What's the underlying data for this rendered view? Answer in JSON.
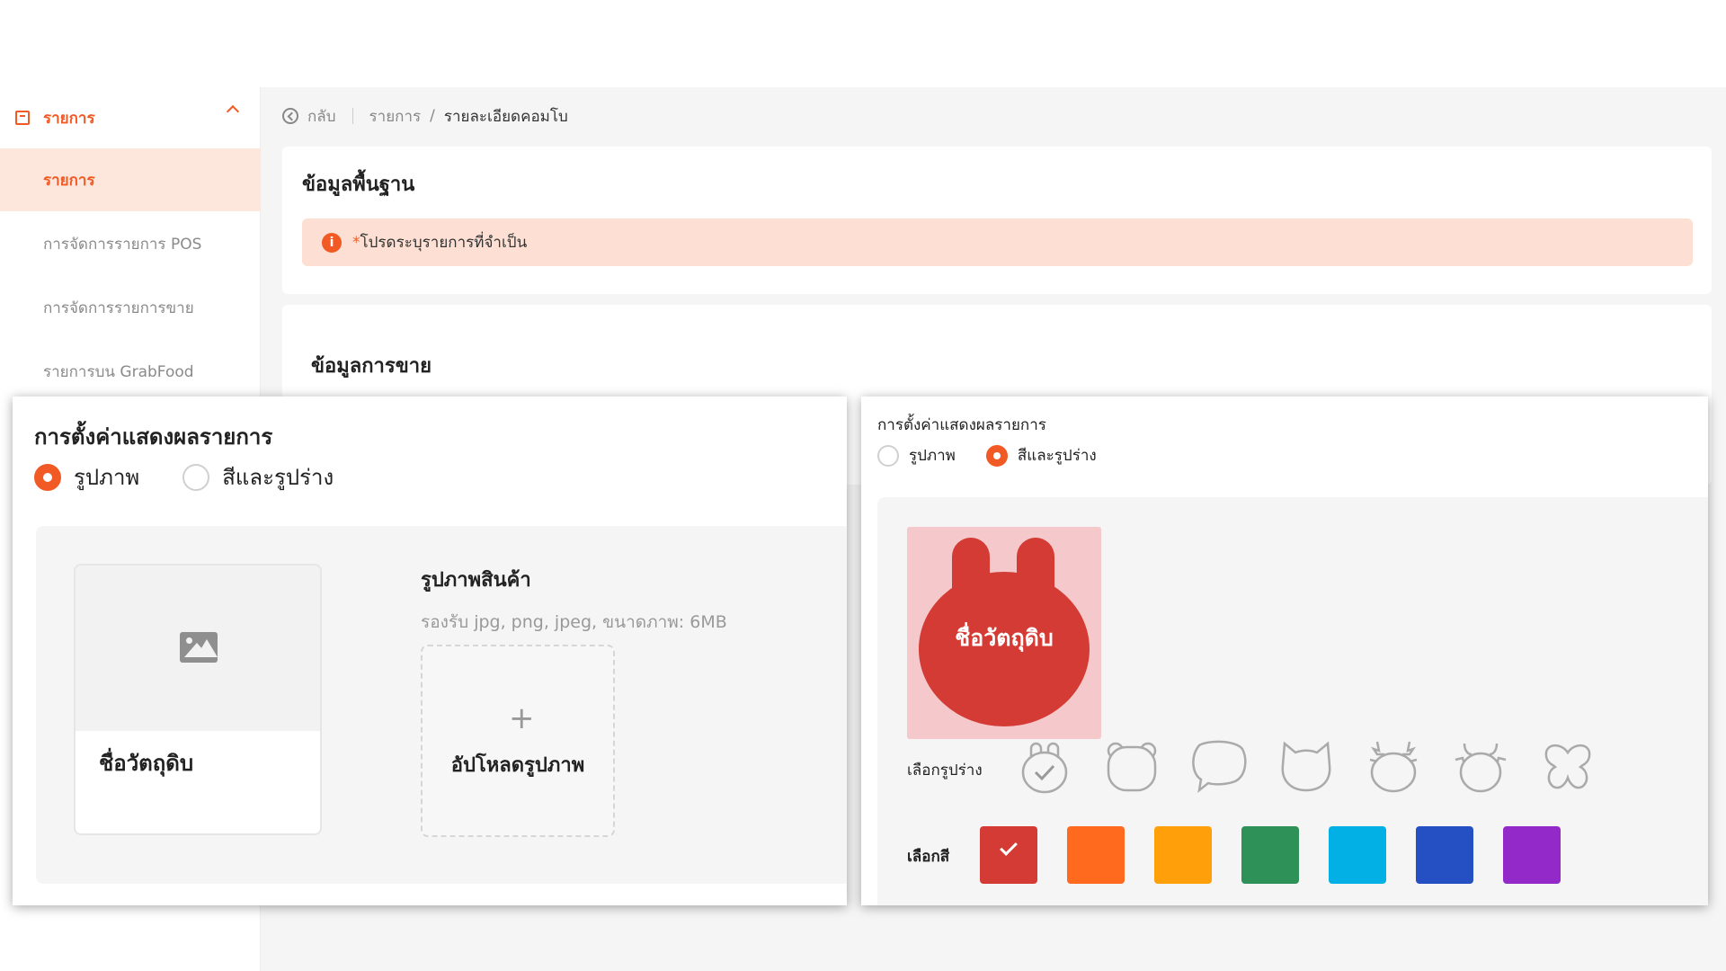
{
  "sidebar": {
    "group_label": "รายการ",
    "items": [
      {
        "label": "รายการ",
        "active": true
      },
      {
        "label": "การจัดการรายการ POS",
        "active": false
      },
      {
        "label": "การจัดการรายการขาย",
        "active": false
      },
      {
        "label": "รายการบน GrabFood",
        "active": false
      }
    ]
  },
  "breadcrumb": {
    "back": "กลับ",
    "parent": "รายการ",
    "separator": "/",
    "current": "รายละเอียดคอมโบ"
  },
  "basic_info": {
    "title": "ข้อมูลพื้นฐาน",
    "alert_icon": "i",
    "alert_star": "*",
    "alert_text": "โปรดระบุรายการที่จำเป็น"
  },
  "sales_info": {
    "title": "ข้อมูลการขาย"
  },
  "left_panel": {
    "title": "การตั้งค่าแสดงผลรายการ",
    "options": [
      {
        "label": "รูปภาพ",
        "selected": true
      },
      {
        "label": "สีและรูปร่าง",
        "selected": false
      }
    ],
    "preview_name": "ชื่อวัตถุดิบ",
    "upload_title": "รูปภาพสินค้า",
    "upload_hint": "รองรับ jpg, png, jpeg, ขนาดภาพ: 6MB",
    "upload_plus": "+",
    "upload_label": "อัปโหลดรูปภาพ"
  },
  "right_panel": {
    "title": "การตั้งค่าแสดงผลรายการ",
    "options": [
      {
        "label": "รูปภาพ",
        "selected": false
      },
      {
        "label": "สีและรูปร่าง",
        "selected": true
      }
    ],
    "preview_name": "ชื่อวัตถุดิบ",
    "shapes_label": "เลือกรูปร่าง",
    "shapes": [
      "bunny-shape-icon",
      "bear-shape-icon",
      "speech-bubble-shape-icon",
      "cat-shape-icon",
      "reindeer-shape-icon",
      "cow-shape-icon",
      "butterfly-shape-icon"
    ],
    "selected_shape": 0,
    "colors_label": "เลือกสี",
    "colors": [
      "#d33b34",
      "#ff6a1f",
      "#ff9f0a",
      "#2e9158",
      "#03b0e6",
      "#2450c4",
      "#9229c8"
    ],
    "selected_color": 0
  },
  "theme": {
    "accent": "#f15a24",
    "alert_bg": "#fde0d3"
  }
}
